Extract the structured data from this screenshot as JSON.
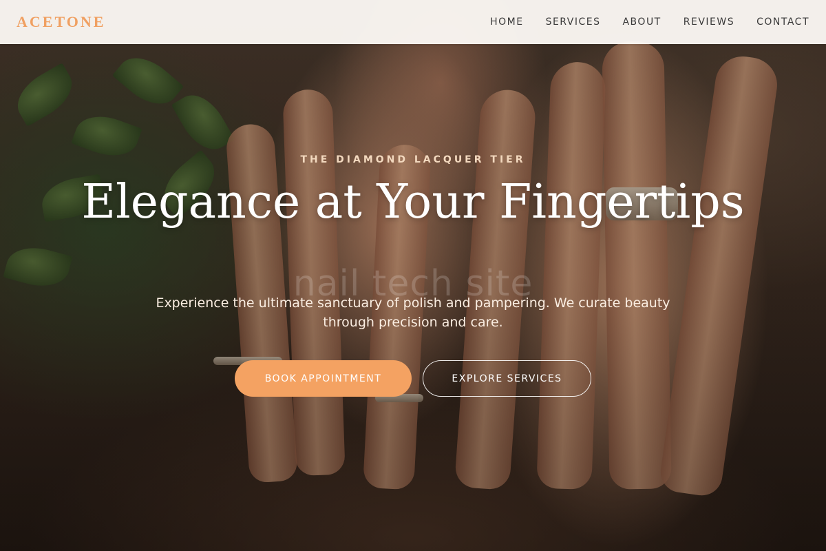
{
  "colors": {
    "brand": "#f0a062",
    "primary_button": "#f4a262",
    "nav_background": "#fdfaf6",
    "nav_text": "#3a3a3a"
  },
  "navbar": {
    "brand": "ACETONE",
    "links": [
      {
        "label": "HOME"
      },
      {
        "label": "SERVICES"
      },
      {
        "label": "ABOUT"
      },
      {
        "label": "REVIEWS"
      },
      {
        "label": "CONTACT"
      }
    ]
  },
  "hero": {
    "eyebrow": "THE DIAMOND LACQUER TIER",
    "headline": "Elegance at Your Fingertips",
    "watermark": "nail tech site",
    "subtext": "Experience the ultimate sanctuary of polish and pampering. We curate beauty through precision and care.",
    "primary_cta": "BOOK APPOINTMENT",
    "secondary_cta": "EXPLORE SERVICES"
  }
}
